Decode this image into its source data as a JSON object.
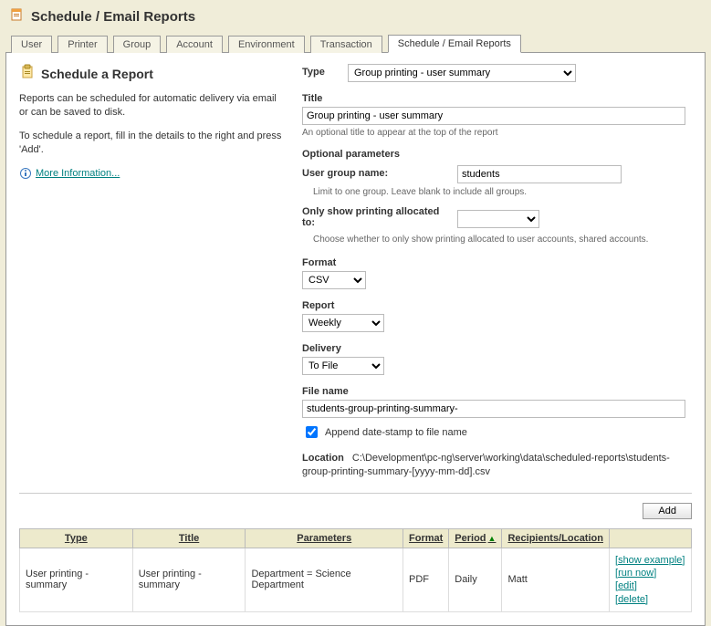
{
  "page": {
    "title": "Schedule / Email Reports"
  },
  "tabs": {
    "t0": "User",
    "t1": "Printer",
    "t2": "Group",
    "t3": "Account",
    "t4": "Environment",
    "t5": "Transaction",
    "t6": "Schedule / Email Reports"
  },
  "side": {
    "heading": "Schedule a Report",
    "p1": "Reports can be scheduled for automatic delivery via email or can be saved to disk.",
    "p2": "To schedule a report, fill in the details to the right and press 'Add'.",
    "moreInfo": "More Information..."
  },
  "form": {
    "typeLabel": "Type",
    "typeValue": "Group printing - user summary",
    "titleLabel": "Title",
    "titleValue": "Group printing - user summary",
    "titleHint": "An optional title to appear at the top of the report",
    "optionalHeading": "Optional parameters",
    "userGroupLabel": "User group name:",
    "userGroupValue": "students",
    "userGroupHint": "Limit to one group. Leave blank to include all groups.",
    "onlyShowLabel": "Only show printing allocated to:",
    "onlyShowHint": "Choose whether to only show printing allocated to user accounts, shared accounts.",
    "formatLabel": "Format",
    "formatValue": "CSV",
    "reportLabel": "Report",
    "reportValue": "Weekly",
    "deliveryLabel": "Delivery",
    "deliveryValue": "To File",
    "fileNameLabel": "File name",
    "fileNameValue": "students-group-printing-summary-",
    "appendLabel": "Append date-stamp to file name",
    "locationLabel": "Location",
    "locationValue": "C:\\Development\\pc-ng\\server\\working\\data\\scheduled-reports\\students-group-printing-summary-[yyyy-mm-dd].csv",
    "addButton": "Add"
  },
  "table": {
    "headers": {
      "type": "Type",
      "title": "Title",
      "parameters": "Parameters",
      "format": "Format",
      "period": "Period",
      "recipients": "Recipients/Location"
    },
    "row": {
      "type": "User printing - summary",
      "title": "User printing - summary",
      "parameters": "Department = Science Department",
      "format": "PDF",
      "period": "Daily",
      "recipients": "Matt"
    },
    "actions": {
      "showExample": "show example",
      "runNow": "run now",
      "edit": "edit",
      "delete": "delete"
    }
  }
}
